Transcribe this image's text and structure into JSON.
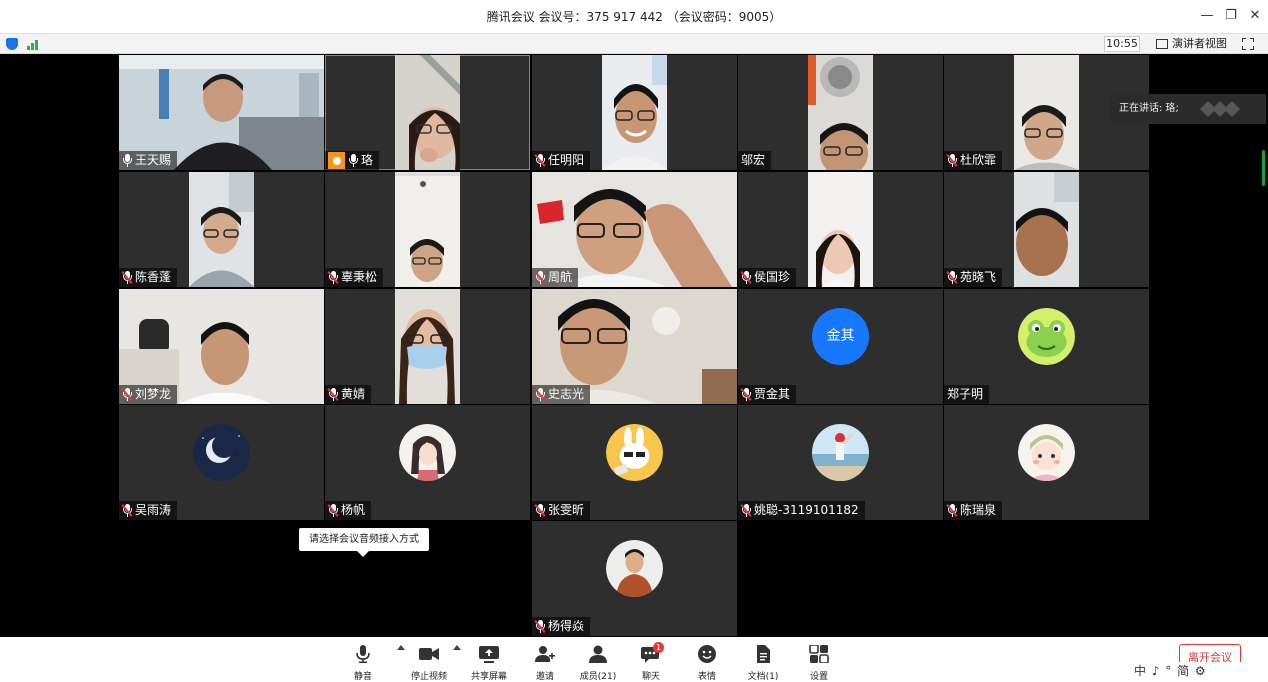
{
  "window": {
    "title": "腾讯会议 会议号：375 917 442 （会议密码：9005）",
    "minimize_icon": "minimize-icon",
    "restore_icon": "restore-icon",
    "close_icon": "close-icon"
  },
  "infobar": {
    "time": "10:55",
    "speaker_view_label": "演讲者视图"
  },
  "speaking": "正在讲话: 珞;",
  "tooltip": "请选择会议音频接入方式",
  "participants": [
    {
      "name": "王天赐",
      "muted": false,
      "video": true
    },
    {
      "name": "珞",
      "muted": false,
      "video": true,
      "host": true,
      "active": true
    },
    {
      "name": "任明阳",
      "muted": true,
      "video": true
    },
    {
      "name": "邬宏",
      "muted": null,
      "video": true
    },
    {
      "name": "杜欣霏",
      "muted": true,
      "video": true
    },
    {
      "name": "陈香蓬",
      "muted": true,
      "video": true
    },
    {
      "name": "辜秉松",
      "muted": true,
      "video": true
    },
    {
      "name": "周航",
      "muted": true,
      "video": true
    },
    {
      "name": "侯国珍",
      "muted": true,
      "video": true
    },
    {
      "name": "苑晓飞",
      "muted": true,
      "video": true
    },
    {
      "name": "刘梦龙",
      "muted": true,
      "video": true
    },
    {
      "name": "黄婧",
      "muted": true,
      "video": true
    },
    {
      "name": "史志光",
      "muted": true,
      "video": true
    },
    {
      "name": "贾金其",
      "muted": true,
      "video": false,
      "avatar_text": "金其"
    },
    {
      "name": "郑子明",
      "muted": null,
      "video": false
    },
    {
      "name": "吴雨涛",
      "muted": true,
      "video": false
    },
    {
      "name": "杨帆",
      "muted": true,
      "video": false
    },
    {
      "name": "张雯昕",
      "muted": true,
      "video": false
    },
    {
      "name": "姚聪-3119101182",
      "muted": true,
      "video": false
    },
    {
      "name": "陈瑞泉",
      "muted": true,
      "video": false
    },
    {
      "name": "杨得焱",
      "muted": true,
      "video": false
    }
  ],
  "toolbar": {
    "mute": "静音",
    "stop_video": "停止视频",
    "share_screen": "共享屏幕",
    "invite": "邀请",
    "members": "成员(21)",
    "chat": "聊天",
    "chat_badge": "1",
    "reactions": "表情",
    "documents": "文档(1)",
    "settings": "设置",
    "leave": "离开会议"
  },
  "ime": "中 ♪ ° 简 ⚙",
  "colors": {
    "host_badge": "#f7941d",
    "active_border": "#4caf50",
    "muted_red": "#e53935",
    "avatar_blue": "#1677ff",
    "leave_red": "#e53935"
  }
}
